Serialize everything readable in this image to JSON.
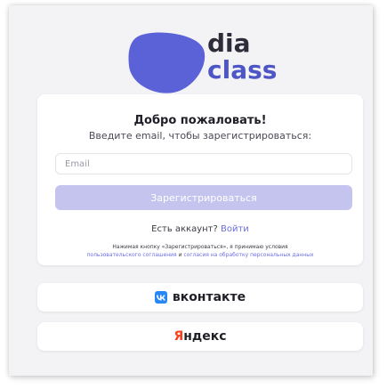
{
  "brand": {
    "word1": "dia",
    "word2": "class",
    "blob_color": "#5b62d8",
    "word2_color": "#4e55c4"
  },
  "form": {
    "title": "Добро пожаловать!",
    "subtitle": "Введите email, чтобы зарегистрироваться:",
    "email_placeholder": "Email",
    "email_value": "",
    "register_label": "Зарегистрироваться",
    "register_color": "#c5c4ef",
    "account_question": "Есть аккаунт?",
    "login_link": "Войти",
    "legal_prefix": "Нажимая кнопку «Зарегистрироваться», я принимаю условия",
    "legal_terms_link": "пользовательского соглашения",
    "legal_and": "и",
    "legal_consent_link": "согласия на обработку персональных данных"
  },
  "social": {
    "vk_icon": "vk-logo-icon",
    "vk_label": "вконтакте",
    "vk_color": "#2787f5",
    "yandex_first": "Я",
    "yandex_rest": "ндекс",
    "yandex_color": "#fc3f1d"
  }
}
